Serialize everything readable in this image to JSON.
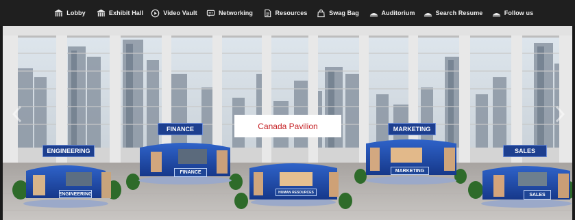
{
  "nav": {
    "items": [
      {
        "label": "Lobby",
        "icon": "lobby-icon"
      },
      {
        "label": "Exhibit Hall",
        "icon": "exhibit-hall-icon"
      },
      {
        "label": "Video Vault",
        "icon": "play-circle-icon"
      },
      {
        "label": "Networking",
        "icon": "chat-icon"
      },
      {
        "label": "Resources",
        "icon": "document-icon"
      },
      {
        "label": "Swag Bag",
        "icon": "bag-icon"
      },
      {
        "label": "Auditorium",
        "icon": "auditorium-icon"
      },
      {
        "label": "Search Resume",
        "icon": "search-resume-icon"
      },
      {
        "label": "Follow us",
        "icon": "follow-icon"
      }
    ]
  },
  "hall": {
    "center_label": "Canada Pavilion",
    "pavilions": [
      {
        "sign": "ENGINEERING",
        "booth_label": "ENGINEERING"
      },
      {
        "sign": "FINANCE",
        "booth_label": "FINANCE"
      },
      {
        "sign": "",
        "booth_label": "HUMAN RESOURCES"
      },
      {
        "sign": "MARKETING",
        "booth_label": "MARKETING"
      },
      {
        "sign": "SALES",
        "booth_label": "SALES"
      }
    ]
  },
  "colors": {
    "nav_bg": "#1f1f1f",
    "booth_blue": "#1e4596",
    "sign_blue": "#1d3f8f",
    "center_label_text": "#c41e22"
  }
}
